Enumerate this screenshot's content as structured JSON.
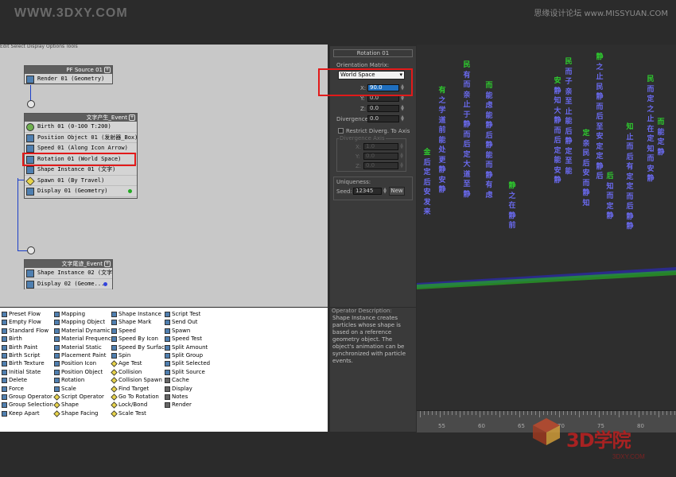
{
  "watermark": {
    "left": "WWW.3DXY.COM",
    "right": "思缘设计论坛 www.MISSYUAN.COM"
  },
  "particle_view": {
    "menu": "Edit  Select  Display  Options  Tools",
    "nodes": [
      {
        "title": "PF Source 01",
        "ops": [
          {
            "text": "Render 01 (Geometry)",
            "icon": "render-icon"
          }
        ]
      },
      {
        "title": "文字产生_Event",
        "ops": [
          {
            "text": "Birth 01 (0-100 T:200)",
            "icon": "birth-icon"
          },
          {
            "text": "Position Object 01 (发射器_Box)",
            "icon": "position-object-icon"
          },
          {
            "text": "Speed 01 (Along Icon Arrow)",
            "icon": "speed-icon"
          },
          {
            "text": "Rotation 01 (World Space)",
            "icon": "rotation-icon"
          },
          {
            "text": "Shape Instance 01 (文字)",
            "icon": "shape-instance-icon"
          },
          {
            "text": "Spawn 01 (By Travel)",
            "icon": "spawn-icon"
          },
          {
            "text": "Display 01 (Geometry)",
            "icon": "display-icon"
          }
        ]
      },
      {
        "title": "文字尾迹_Event",
        "ops": [
          {
            "text": "Shape Instance 02 (文字)",
            "icon": "shape-instance-icon"
          },
          {
            "text": "Display 02 (Geome...",
            "icon": "display-icon"
          }
        ]
      }
    ]
  },
  "rollout": {
    "title": "Rotation 01",
    "orientation_label": "Orientation Matrix:",
    "orientation_value": "World Space",
    "x_label": "X:",
    "x_value": "90.0",
    "y_label": "Y:",
    "y_value": "0.0",
    "z_label": "Z:",
    "z_value": "0.0",
    "divergence_label": "Divergence:",
    "divergence_value": "0.0",
    "restrict_label": "Restrict Diverg. To Axis",
    "div_axis_label": "Divergence Axis",
    "ax_x_label": "X:",
    "ax_x_value": "1.0",
    "ax_y_label": "Y:",
    "ax_y_value": "0.0",
    "ax_z_label": "Z:",
    "ax_z_value": "0.0",
    "uniqueness_label": "Uniqueness:",
    "seed_label": "Seed:",
    "seed_value": "12345",
    "new_label": "New"
  },
  "description": {
    "header": "Operator Description:",
    "text": "Shape Instance creates particles whose shape is based on a reference geometry object. The object's animation can be synchronized with particle events."
  },
  "depot": {
    "columns": [
      [
        "Preset Flow",
        "Empty Flow",
        "Standard Flow",
        "Birth",
        "Birth Paint",
        "Birth Script",
        "Birth Texture",
        "Initial State",
        "Delete",
        "Force",
        "Group Operator",
        "Group Selection",
        "Keep Apart"
      ],
      [
        "Mapping",
        "Mapping Object",
        "Material Dynamic",
        "Material Frequency",
        "Material Static",
        "Placement Paint",
        "Position Icon",
        "Position Object",
        "Rotation",
        "Scale",
        "Script Operator",
        "Shape",
        "Shape Facing"
      ],
      [
        "Shape Instance",
        "Shape Mark",
        "Speed",
        "Speed By Icon",
        "Speed By Surface",
        "Spin",
        "Age Test",
        "Collision",
        "Collision Spawn",
        "Find Target",
        "Go To Rotation",
        "Lock/Bond",
        "Scale Test"
      ],
      [
        "Script Test",
        "Send Out",
        "Spawn",
        "Speed Test",
        "Split Amount",
        "Split Group",
        "Split Selected",
        "Split Source",
        "Cache",
        "Display",
        "Notes",
        "Render"
      ]
    ]
  },
  "viewport": {
    "columns": [
      "金后定后安发来",
      "有之学道前能处更静安静",
      "民有而亲止于静而后定大道至静",
      "而能虑能静后静能而静有虑",
      "静之在静前",
      "安静知大静而后定能安静",
      "民而子亲至止能后静定至能",
      "定亲民后安而静知",
      "静之止民静而后至安定定静后",
      "后知而定静",
      "知止而后有定定而后静静",
      "民而定之止在定知而安静",
      "而能定静"
    ],
    "timeline_labels": [
      "55",
      "60",
      "65",
      "70",
      "75",
      "80"
    ]
  },
  "logo": {
    "text": "3D学院",
    "url": "3DXY.COM"
  },
  "colors": {
    "highlight": "#e21a1a",
    "wire": "#1c3fc8",
    "particle_top": "#2ecc2e",
    "particle_body": "#6a6af0"
  }
}
